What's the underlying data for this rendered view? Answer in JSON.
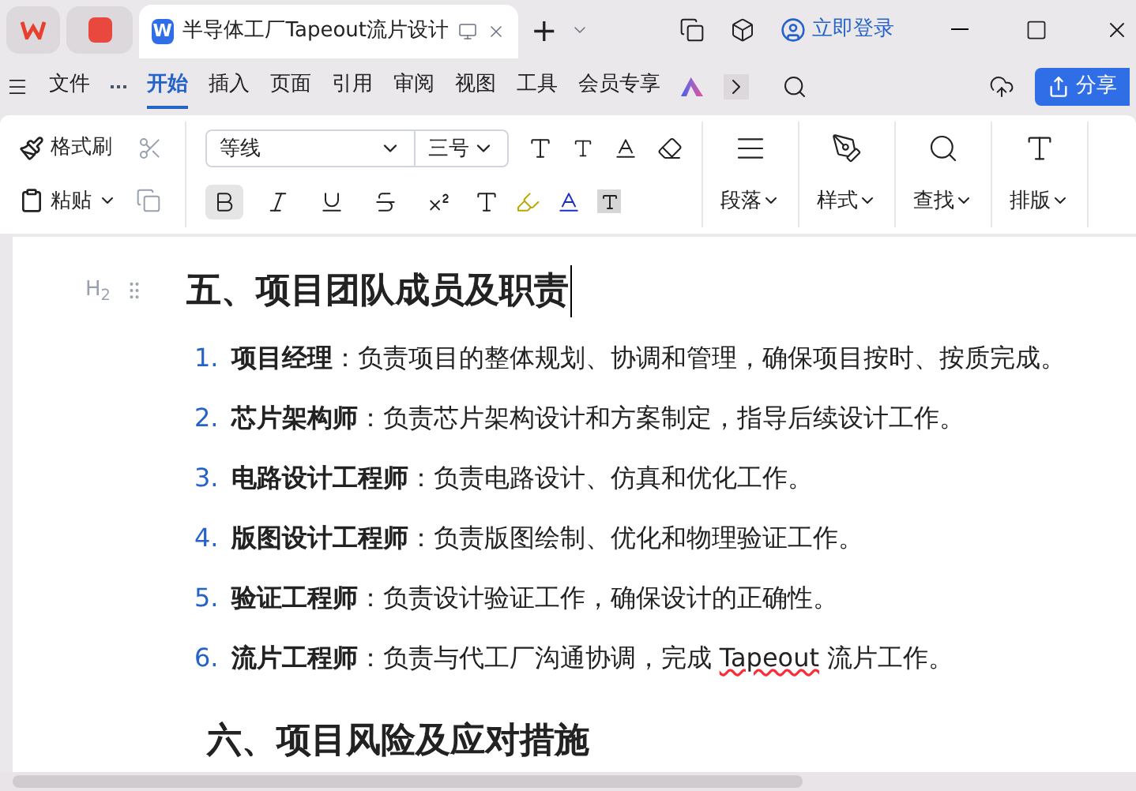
{
  "window": {
    "doc_badge": "W",
    "tab_title": "半导体工厂Tapeout流片设计",
    "add_tab": "+",
    "account": "立即登录"
  },
  "menu": {
    "items": [
      {
        "label": "文件",
        "selected": false
      },
      {
        "label": "开始",
        "selected": true
      },
      {
        "label": "插入",
        "selected": false
      },
      {
        "label": "页面",
        "selected": false
      },
      {
        "label": "引用",
        "selected": false
      },
      {
        "label": "审阅",
        "selected": false
      },
      {
        "label": "视图",
        "selected": false
      },
      {
        "label": "工具",
        "selected": false
      },
      {
        "label": "会员专享",
        "selected": false
      }
    ],
    "share": "分享"
  },
  "ribbon": {
    "format_painter": "格式刷",
    "paste": "粘贴",
    "font": "等线",
    "size": "三号",
    "format_buttons": [
      {
        "kind": "bold",
        "selected": true
      },
      {
        "kind": "italic",
        "selected": false
      },
      {
        "kind": "underline",
        "selected": false
      },
      {
        "kind": "strike",
        "selected": false
      },
      {
        "kind": "superscript",
        "selected": false
      }
    ],
    "groups": [
      {
        "kind": "paragraph",
        "label": "段落"
      },
      {
        "kind": "style",
        "label": "样式"
      },
      {
        "kind": "find",
        "label": "查找"
      },
      {
        "kind": "layout",
        "label": "排版"
      }
    ]
  },
  "document": {
    "heading_tag": "H$_{2}$",
    "heading": "五、项目团队成员及职责",
    "items": [
      {
        "number": "1.",
        "term": "项目经理",
        "parts": [
          {
            "text": "：负责项目的整体规划、协调和管理，确保项目按时、按质完成。",
            "misspelled": false
          }
        ]
      },
      {
        "number": "2.",
        "term": "芯片架构师",
        "parts": [
          {
            "text": "：负责芯片架构设计和方案制定，指导后续设计工作。",
            "misspelled": false
          }
        ]
      },
      {
        "number": "3.",
        "term": "电路设计工程师",
        "parts": [
          {
            "text": "：负责电路设计、仿真和优化工作。",
            "misspelled": false
          }
        ]
      },
      {
        "number": "4.",
        "term": "版图设计工程师",
        "parts": [
          {
            "text": "：负责版图绘制、优化和物理验证工作。",
            "misspelled": false
          }
        ]
      },
      {
        "number": "5.",
        "term": "验证工程师",
        "parts": [
          {
            "text": "：负责设计验证工作，确保设计的正确性。",
            "misspelled": false
          }
        ]
      },
      {
        "number": "6.",
        "term": "流片工程师",
        "parts": [
          {
            "text": "：负责与代工厂沟通协调，完成 ",
            "misspelled": false
          },
          {
            "text": "Tapeout",
            "misspelled": true
          },
          {
            "text": " 流片工作。",
            "misspelled": false
          }
        ]
      }
    ],
    "next_heading": "六、项目风险及应对措施"
  }
}
